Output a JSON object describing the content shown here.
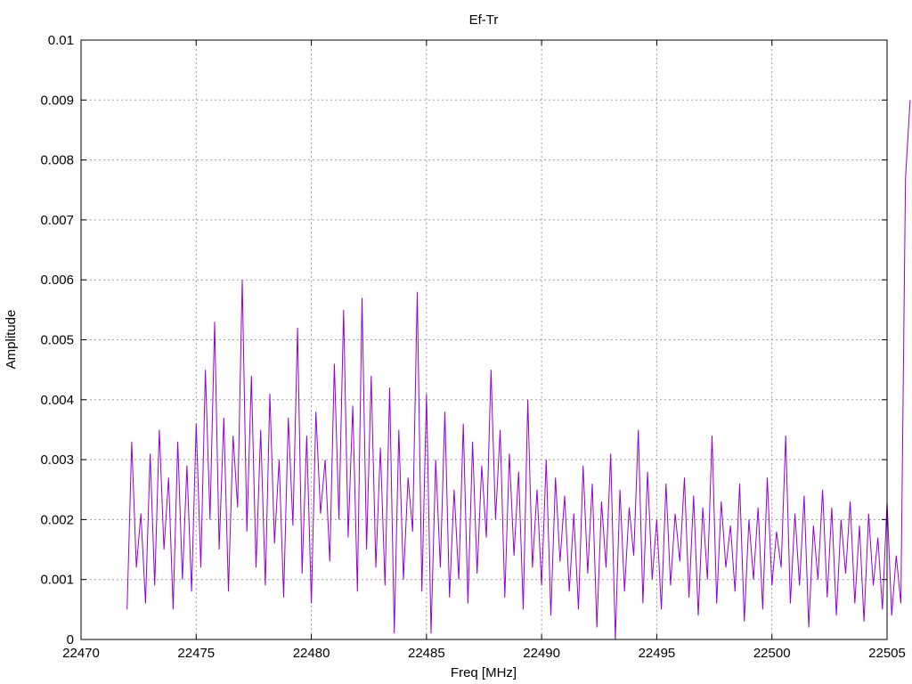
{
  "chart_data": {
    "type": "line",
    "title": "Ef-Tr",
    "xlabel": "Freq [MHz]",
    "ylabel": "Amplitude",
    "xlim": [
      22470,
      22505
    ],
    "ylim": [
      0,
      0.01
    ],
    "grid": true,
    "legend": "none",
    "xticks": [
      "22470",
      "22475",
      "22480",
      "22485",
      "22490",
      "22495",
      "22500",
      "22505"
    ],
    "yticks": [
      "0",
      "0.001",
      "0.002",
      "0.003",
      "0.004",
      "0.005",
      "0.006",
      "0.007",
      "0.008",
      "0.009",
      "0.01"
    ],
    "series": [
      {
        "name": "Ef-Tr",
        "color": "#9400d3",
        "x_start": 22472.0,
        "x_step": 0.2,
        "values": [
          0.0005,
          0.0033,
          0.0012,
          0.0021,
          0.0006,
          0.0031,
          0.0009,
          0.0035,
          0.0015,
          0.0027,
          0.0005,
          0.0033,
          0.001,
          0.0029,
          0.0008,
          0.0036,
          0.0012,
          0.0045,
          0.002,
          0.0053,
          0.0015,
          0.0037,
          0.0008,
          0.0034,
          0.0022,
          0.006,
          0.0018,
          0.0044,
          0.0012,
          0.0035,
          0.0009,
          0.0041,
          0.0016,
          0.003,
          0.0007,
          0.0037,
          0.0019,
          0.0052,
          0.0011,
          0.0034,
          0.0006,
          0.0038,
          0.0021,
          0.003,
          0.0013,
          0.0046,
          0.002,
          0.0055,
          0.0017,
          0.0039,
          0.0008,
          0.0057,
          0.0015,
          0.0044,
          0.0012,
          0.0032,
          0.0009,
          0.0042,
          0.0001,
          0.0035,
          0.001,
          0.0027,
          0.0018,
          0.0058,
          0.0008,
          0.0041,
          0.0001,
          0.003,
          0.0012,
          0.0038,
          0.0007,
          0.0025,
          0.001,
          0.0036,
          0.0006,
          0.0033,
          0.0011,
          0.0029,
          0.0017,
          0.0045,
          0.002,
          0.0035,
          0.0007,
          0.0031,
          0.0014,
          0.0028,
          0.0005,
          0.004,
          0.0012,
          0.0025,
          0.0009,
          0.003,
          0.0004,
          0.0027,
          0.0013,
          0.0024,
          0.0008,
          0.0021,
          0.0005,
          0.0029,
          0.0011,
          0.0026,
          0.0002,
          0.0023,
          0.0012,
          0.0031,
          0.0,
          0.0025,
          0.0008,
          0.0022,
          0.0014,
          0.0035,
          0.0006,
          0.0028,
          0.001,
          0.002,
          0.0005,
          0.0026,
          0.0009,
          0.0021,
          0.0013,
          0.0027,
          0.0007,
          0.0024,
          0.0004,
          0.0022,
          0.001,
          0.0034,
          0.0006,
          0.0023,
          0.0012,
          0.0019,
          0.0008,
          0.0026,
          0.0003,
          0.002,
          0.001,
          0.0022,
          0.0005,
          0.0027,
          0.0009,
          0.0018,
          0.0012,
          0.0034,
          0.0006,
          0.0021,
          0.0009,
          0.0024,
          0.0002,
          0.0019,
          0.001,
          0.0025,
          0.0007,
          0.0022,
          0.0004,
          0.002,
          0.0011,
          0.0023,
          0.0006,
          0.0019,
          0.0003,
          0.0021,
          0.0009,
          0.0017,
          0.0005,
          0.0023,
          0.0004,
          0.0014,
          0.0006,
          0.0077,
          0.009
        ]
      }
    ]
  }
}
